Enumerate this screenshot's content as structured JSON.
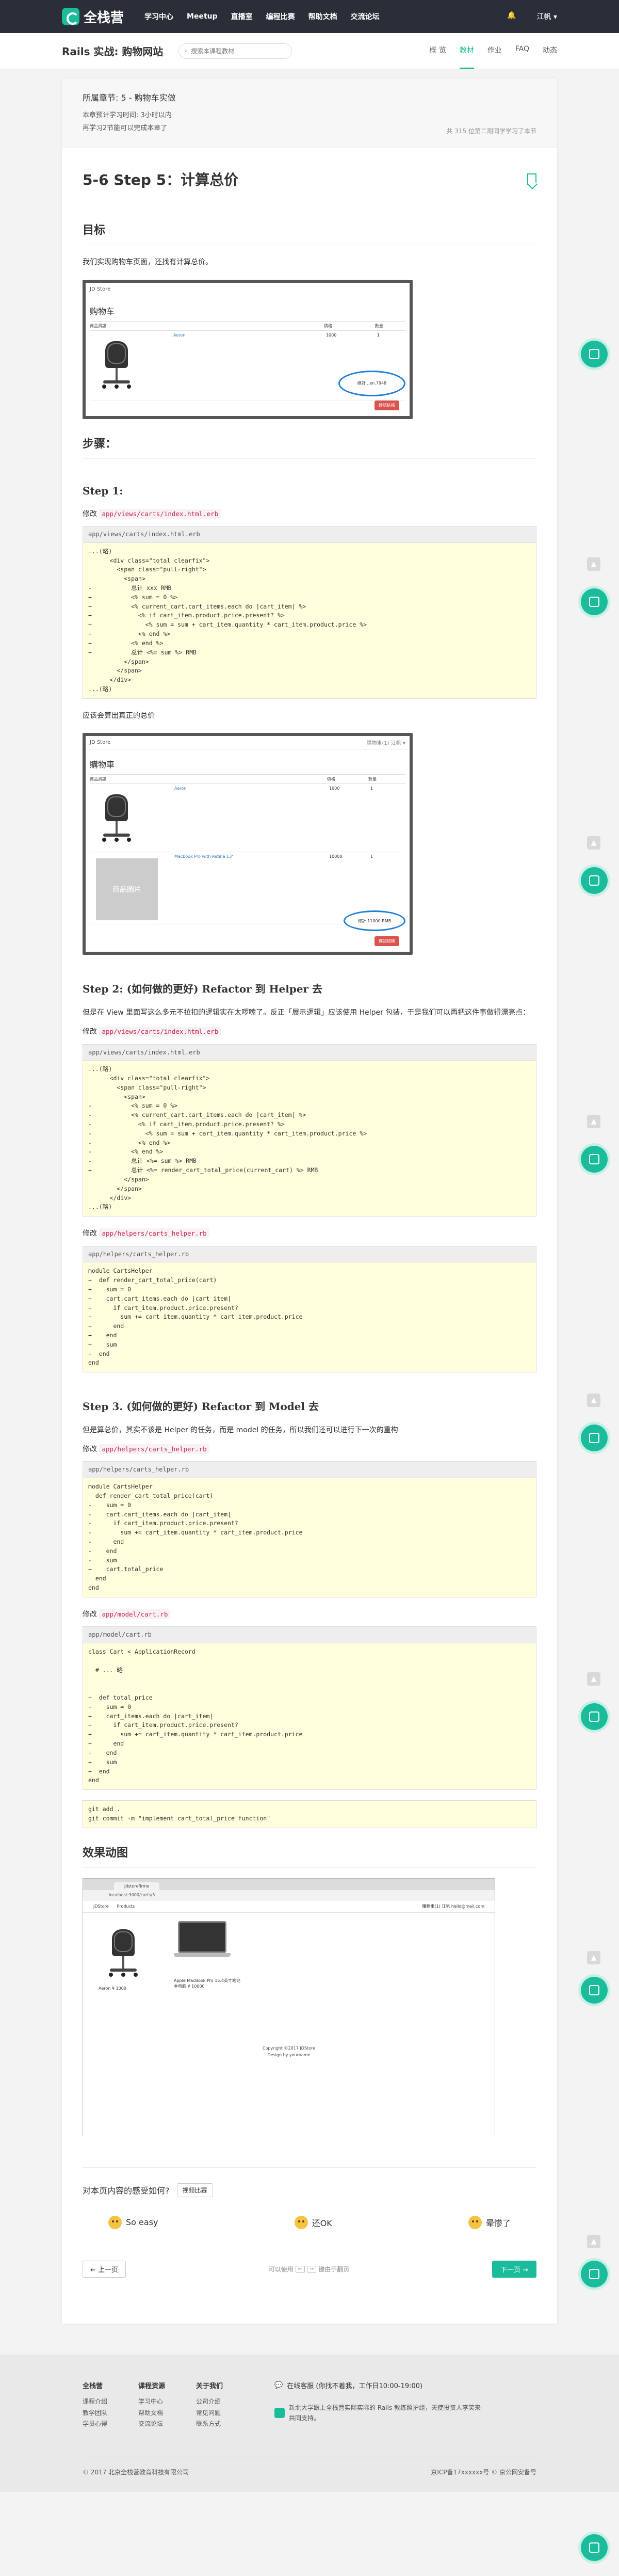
{
  "topnav": {
    "brand": "全栈营",
    "items": [
      "学习中心",
      "Meetup",
      "直播室",
      "编程比赛",
      "帮助文档",
      "交流论坛"
    ],
    "notifications_icon": "bell-icon",
    "user": "江帆 ▾"
  },
  "subbar": {
    "course_title": "Rails 实战: 购物网站",
    "search_placeholder": "搜索本课程教材",
    "tabs": [
      "概 览",
      "教材",
      "作业",
      "FAQ",
      "动态"
    ],
    "active_tab": "教材"
  },
  "chapter": {
    "name": "所属章节: 5 - 购物车实做",
    "line1": "本章预计学习时间: 3小时以内",
    "line2": "再学习2节能可以完成本章了",
    "meta": "共 315 位第二期同学学习了本节"
  },
  "section_title": "5-6 Step 5：计算总价",
  "goal": {
    "heading": "目标",
    "text": "我们实现购物车页面，还找有计算总价。"
  },
  "shot1": {
    "brand": "JD Store",
    "title": "购物车",
    "headers": [
      "商品資訊",
      "",
      "價格",
      "數量"
    ],
    "item_name": "Aeron",
    "price": "1000",
    "qty": "1",
    "total_label": "總計 ..en.7948",
    "pay": "確認結帳"
  },
  "steps_heading": "步骤：",
  "step1": {
    "heading": "Step 1:",
    "edit_label": "修改",
    "file": "app/views/carts/index.html.erb",
    "after": "应该会算出真正的总价"
  },
  "code1": [
    {
      "t": "...(略)"
    },
    {
      "t": "      <div class=\"total clearfix\">"
    },
    {
      "t": "        <span class=\"pull-right\">"
    },
    {
      "t": "          <span>"
    },
    {
      "t": "-           总计 xxx RMB"
    },
    {
      "t": "+           <% sum = 0 %>"
    },
    {
      "t": "+           <% current_cart.cart_items.each do |cart_item| %>"
    },
    {
      "t": "+             <% if cart_item.product.price.present? %>"
    },
    {
      "t": "+               <% sum = sum + cart_item.quantity * cart_item.product.price %>"
    },
    {
      "t": "+             <% end %>"
    },
    {
      "t": "+           <% end %>"
    },
    {
      "t": "+           总计 <%= sum %> RMB"
    },
    {
      "t": "          </span>"
    },
    {
      "t": "        </span>"
    },
    {
      "t": "      </div>"
    },
    {
      "t": "...(略)"
    }
  ],
  "shot2": {
    "brand": "JD Store",
    "nav_right": "購物車(1)   江帆 ▾",
    "title": "購物車",
    "headers": [
      "商品資訊",
      "",
      "價格",
      "數量"
    ],
    "rows": [
      {
        "name": "Aeron",
        "price": "1000",
        "qty": "1"
      },
      {
        "name": "Macbook Pro with Retina 13\"",
        "price": "10000",
        "qty": "1"
      }
    ],
    "placeholder": "商品圖片",
    "total_label": "總計 11000 RMB",
    "pay": "確認結帳"
  },
  "step2": {
    "heading": "Step 2: (如何做的更好) Refactor 到 Helper 去",
    "text": "但是在 View 里面写这么多元不拉扣的逻辑实在太啰嗦了。反正「展示逻辑」应该使用 Helper 包装，于是我们可以再把这件事做得漂亮点：",
    "edit_label": "修改",
    "file1": "app/views/carts/index.html.erb",
    "file2": "app/helpers/carts_helper.rb"
  },
  "code2": [
    {
      "t": "...(略)"
    },
    {
      "t": "      <div class=\"total clearfix\">"
    },
    {
      "t": "        <span class=\"pull-right\">"
    },
    {
      "t": "          <span>"
    },
    {
      "t": "-           <% sum = 0 %>"
    },
    {
      "t": "-           <% current_cart.cart_items.each do |cart_item| %>"
    },
    {
      "t": "-             <% if cart_item.product.price.present? %>"
    },
    {
      "t": "-               <% sum = sum + cart_item.quantity * cart_item.product.price %>"
    },
    {
      "t": "-             <% end %>"
    },
    {
      "t": "-           <% end %>"
    },
    {
      "t": "-           总计 <%= sum %> RMB"
    },
    {
      "t": "+           总计 <%= render_cart_total_price(current_cart) %> RMB"
    },
    {
      "t": "          </span>"
    },
    {
      "t": "        </span>"
    },
    {
      "t": "      </div>"
    },
    {
      "t": "...(略)"
    }
  ],
  "code3": [
    {
      "t": "module CartsHelper"
    },
    {
      "t": "+  def render_cart_total_price(cart)"
    },
    {
      "t": "+    sum = 0"
    },
    {
      "t": "+    cart.cart_items.each do |cart_item|"
    },
    {
      "t": "+      if cart_item.product.price.present?"
    },
    {
      "t": "+        sum += cart_item.quantity * cart_item.product.price"
    },
    {
      "t": "+      end"
    },
    {
      "t": "+    end"
    },
    {
      "t": "+    sum"
    },
    {
      "t": "+  end"
    },
    {
      "t": "end"
    }
  ],
  "step3": {
    "heading": "Step 3. (如何做的更好) Refactor 到 Model 去",
    "text": "但是算总价，其实不该是 Helper 的任务，而是 model 的任务，所以我们还可以进行下一次的重构",
    "edit_label": "修改",
    "file1": "app/helpers/carts_helper.rb",
    "file2": "app/model/cart.rb"
  },
  "code4": [
    {
      "t": "module CartsHelper"
    },
    {
      "t": "  def render_cart_total_price(cart)"
    },
    {
      "t": "-    sum = 0"
    },
    {
      "t": "-    cart.cart_items.each do |cart_item|"
    },
    {
      "t": "-      if cart_item.product.price.present?"
    },
    {
      "t": "-        sum += cart_item.quantity * cart_item.product.price"
    },
    {
      "t": "-      end"
    },
    {
      "t": "-    end"
    },
    {
      "t": "-    sum"
    },
    {
      "t": "+    cart.total_price"
    },
    {
      "t": "  end"
    },
    {
      "t": "end"
    }
  ],
  "code5": [
    {
      "t": "class Cart < ApplicationRecord"
    },
    {
      "t": ""
    },
    {
      "t": "  # ... 略"
    },
    {
      "t": ""
    },
    {
      "t": ""
    },
    {
      "t": "+  def total_price"
    },
    {
      "t": "+    sum = 0"
    },
    {
      "t": "+    cart_items.each do |cart_item|"
    },
    {
      "t": "+      if cart_item.product.price.present?"
    },
    {
      "t": "+        sum += cart_item.quantity * cart_item.product.price"
    },
    {
      "t": "+      end"
    },
    {
      "t": "+    end"
    },
    {
      "t": "+    sum"
    },
    {
      "t": "+  end"
    },
    {
      "t": "end"
    }
  ],
  "code6": [
    {
      "t": "git add ."
    },
    {
      "t": "git commit -m \"implement cart_total_price function\""
    }
  ],
  "effect": {
    "heading": "效果动图",
    "tab": "jdstorefirmo",
    "url": "localhost:3000/carts/3",
    "brand": "JDStore",
    "nav": "Products",
    "nav_right": "購物車(1)   江帆 hello@mail.com",
    "item1": "Aeron  ¥ 1000",
    "item2": "Apple MacBook Pro 15.4英寸笔记本电脑 ¥ 10000",
    "copyright": "Copyright ©2017 JDStore",
    "design": "Design by yourname"
  },
  "feedback": {
    "question": "对本页内容的感受如何?",
    "plan": "视频比赛",
    "votes": [
      "So easy",
      "还OK",
      "晕惨了"
    ]
  },
  "pager": {
    "prev": "上一页",
    "hint_pre": "可以使用",
    "hint_mid": "键由于翻页",
    "left_key": "←",
    "right_key": "→",
    "next": "下一页"
  },
  "footer": {
    "cols": [
      {
        "title": "全栈营",
        "items": [
          "课程介绍",
          "教学团队",
          "学员心得"
        ]
      },
      {
        "title": "课程资源",
        "items": [
          "学习中心",
          "帮助文档",
          "交流论坛"
        ]
      },
      {
        "title": "关于我们",
        "items": [
          "公司介绍",
          "常见问题",
          "联系方式"
        ]
      }
    ],
    "online": "在线客服 (你找不着我，工作日10:00-19:00)",
    "desc": "新北大学跟上全栈营实际实际的 Rails 教练照护组，天使投资人李笑来共同支持。",
    "copyright": "© 2017 北京全栈营教育科技有限公司",
    "icp": "京ICP备17xxxxxx号 © 京公网安备号"
  }
}
